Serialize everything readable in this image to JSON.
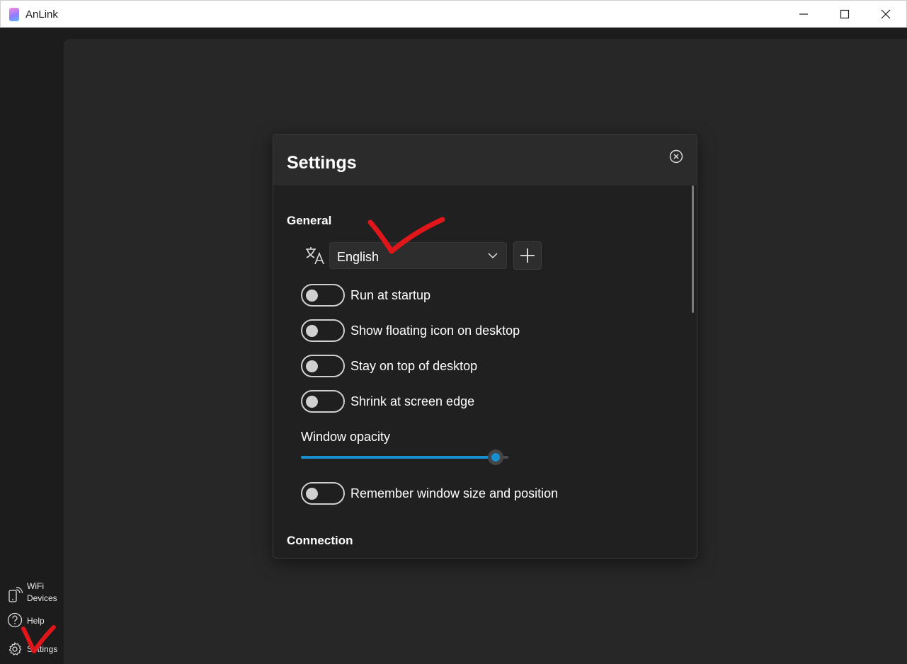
{
  "window": {
    "title": "AnLink"
  },
  "sidebar": {
    "items": [
      {
        "label_line1": "WiFi",
        "label_line2": "Devices",
        "icon": "phone-wifi-icon"
      },
      {
        "label": "Help",
        "icon": "help-icon"
      },
      {
        "label": "Settings",
        "icon": "gear-icon"
      }
    ]
  },
  "settings": {
    "title": "Settings",
    "general_heading": "General",
    "language": {
      "selected": "English",
      "icon": "translate-icon"
    },
    "toggles": [
      {
        "label": "Run at startup",
        "on": false
      },
      {
        "label": "Show floating icon on desktop",
        "on": false
      },
      {
        "label": "Stay on top of desktop",
        "on": false
      },
      {
        "label": "Shrink at screen edge",
        "on": false
      }
    ],
    "opacity": {
      "label": "Window opacity",
      "value": 0.94
    },
    "remember": {
      "label": "Remember window size and position",
      "on": false
    },
    "connection_heading": "Connection"
  },
  "colors": {
    "accent": "#1a8fd0",
    "annotation": "#e0161b"
  }
}
